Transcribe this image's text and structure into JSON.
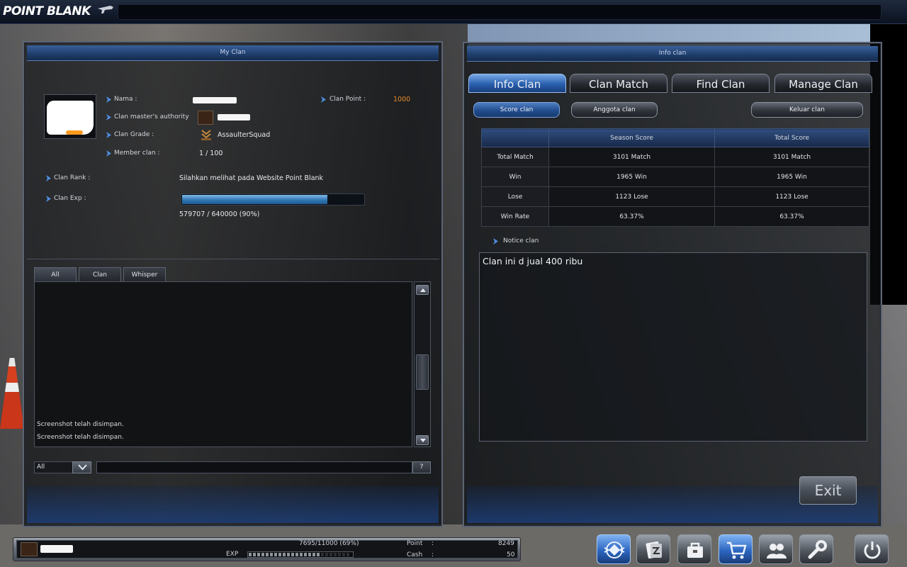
{
  "header": {
    "logo": "POINT BLANK"
  },
  "my_clan": {
    "title": "My Clan",
    "fields": {
      "nama_label": "Nama :",
      "master_label": "Clan master's authority",
      "grade_label": "Clan Grade :",
      "grade_value": "AssaulterSquad",
      "member_label": "Member clan :",
      "member_value": "1 / 100",
      "point_label": "Clan Point :",
      "point_value": "1000",
      "rank_label": "Clan Rank :",
      "rank_value": "Silahkan melihat pada Website Point Blank",
      "exp_label": "Clan Exp :",
      "exp_value": "579707 / 640000 (90%)",
      "exp_fraction": 0.9
    },
    "chat": {
      "tabs": [
        "All",
        "Clan",
        "Whisper"
      ],
      "messages": [
        "Screenshot telah disimpan.",
        "Screenshot telah disimpan."
      ],
      "channel": "All",
      "help": "?"
    }
  },
  "info_clan": {
    "title": "Info clan",
    "tabs": [
      "Info Clan",
      "Clan Match",
      "Find Clan",
      "Manage Clan"
    ],
    "buttons": {
      "score": "Score clan",
      "members": "Anggota clan",
      "leave": "Keluar clan"
    },
    "table": {
      "headers": [
        "",
        "Season Score",
        "Total Score"
      ],
      "rows": [
        [
          "Total Match",
          "3101 Match",
          "3101 Match"
        ],
        [
          "Win",
          "1965 Win",
          "1965 Win"
        ],
        [
          "Lose",
          "1123 Lose",
          "1123 Lose"
        ],
        [
          "Win Rate",
          "63.37%",
          "63.37%"
        ]
      ]
    },
    "notice_label": "Notice clan",
    "notice_text": "Clan ini d jual 400 ribu",
    "exit": "Exit"
  },
  "status_bar": {
    "exp_text": "7695/11000 (69%)",
    "exp_label": "EXP",
    "exp_fraction": 0.69,
    "point_label": "Point",
    "point_sep": ":",
    "point_value": "8249",
    "cash_label": "Cash",
    "cash_sep": ":",
    "cash_value": "50"
  },
  "toolbar_icons": [
    "clan-emblem-icon",
    "inventory-icon",
    "shop-bag-icon",
    "cart-icon",
    "community-icon",
    "settings-wrench-icon",
    "power-icon"
  ],
  "colors": {
    "accent_blue": "#2a5fae",
    "point_orange": "#e88a2a"
  }
}
